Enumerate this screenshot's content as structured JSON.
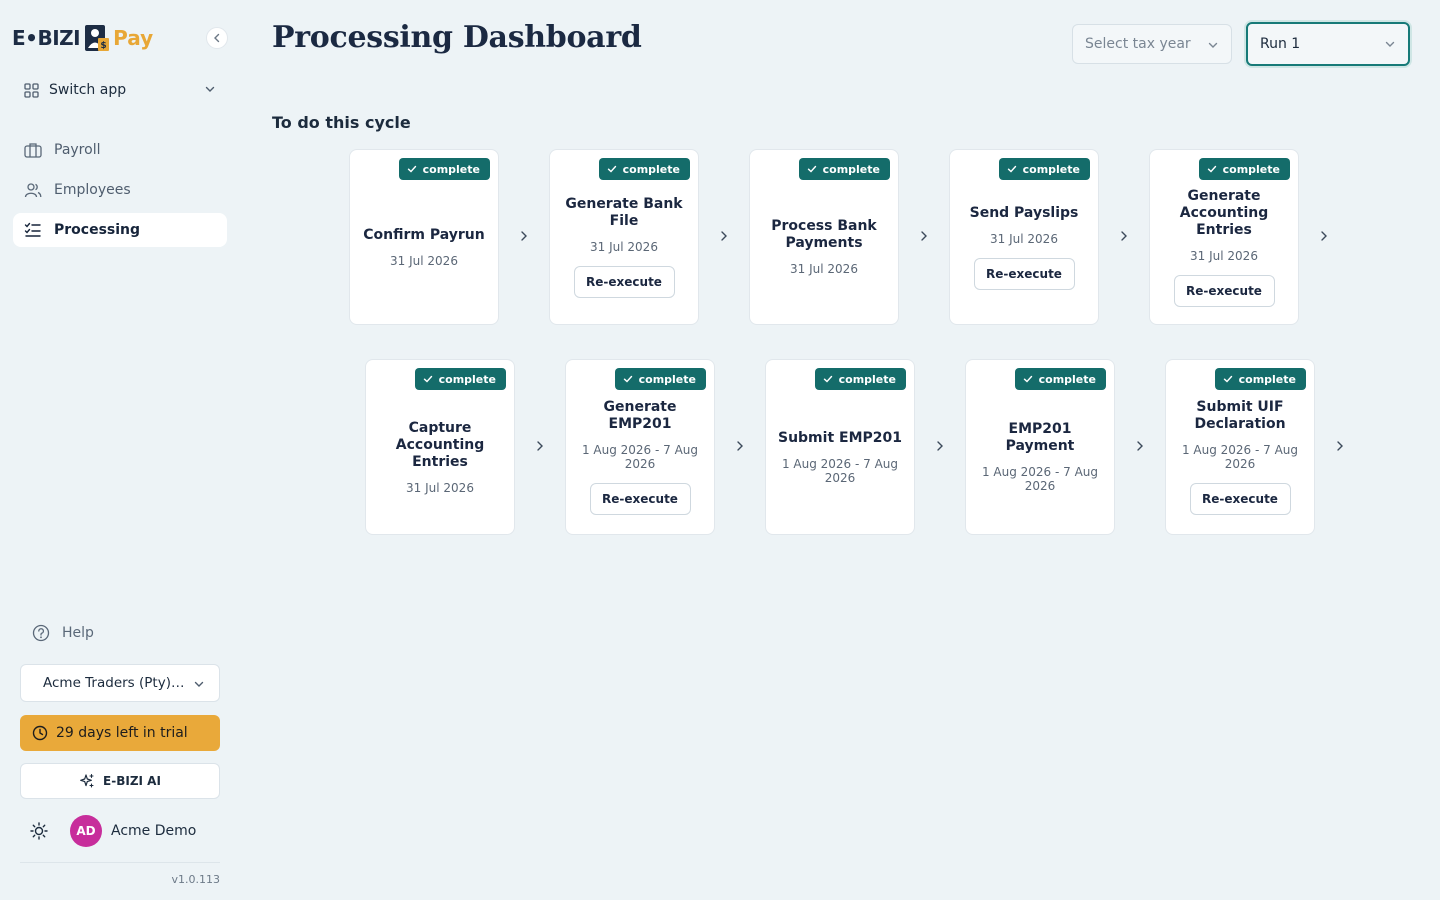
{
  "brand": {
    "name_left": "E•BIZI",
    "name_right": "Pay"
  },
  "sidebar": {
    "switch_app": "Switch app",
    "nav": [
      {
        "label": "Payroll",
        "icon": "briefcase-icon"
      },
      {
        "label": "Employees",
        "icon": "users-icon"
      },
      {
        "label": "Processing",
        "icon": "list-check-icon",
        "active": true
      }
    ],
    "help": "Help",
    "company": "Acme Traders (Pty)…",
    "trial": "29 days left in trial",
    "ai": "E-BIZI AI",
    "user": {
      "initials": "AD",
      "name": "Acme Demo"
    },
    "version": "v1.0.113"
  },
  "header": {
    "title": "Processing Dashboard",
    "tax_year_placeholder": "Select tax year",
    "run": "Run 1"
  },
  "section_title": "To do this cycle",
  "steps": [
    {
      "title": "Confirm Payrun",
      "date": "31 Jul 2026",
      "status": "complete",
      "action": ""
    },
    {
      "title": "Generate Bank File",
      "date": "31 Jul 2026",
      "status": "complete",
      "action": "Re-execute"
    },
    {
      "title": "Process Bank Payments",
      "date": "31 Jul 2026",
      "status": "complete",
      "action": ""
    },
    {
      "title": "Send Payslips",
      "date": "31 Jul 2026",
      "status": "complete",
      "action": "Re-execute"
    },
    {
      "title": "Generate Accounting Entries",
      "date": "31 Jul 2026",
      "status": "complete",
      "action": "Re-execute"
    },
    {
      "title": "Capture Accounting Entries",
      "date": "31 Jul 2026",
      "status": "complete",
      "action": ""
    },
    {
      "title": "Generate EMP201",
      "date": "1 Aug 2026 - 7 Aug 2026",
      "status": "complete",
      "action": "Re-execute"
    },
    {
      "title": "Submit EMP201",
      "date": "1 Aug 2026 - 7 Aug 2026",
      "status": "complete",
      "action": ""
    },
    {
      "title": "EMP201 Payment",
      "date": "1 Aug 2026 - 7 Aug 2026",
      "status": "complete",
      "action": ""
    },
    {
      "title": "Submit UIF Declaration",
      "date": "1 Aug 2026 - 7 Aug 2026",
      "status": "complete",
      "action": "Re-execute"
    }
  ],
  "colors": {
    "accent": "#146c6a",
    "trial": "#e9a93a",
    "avatar": "#c72d9b",
    "background": "#edf3f6"
  }
}
